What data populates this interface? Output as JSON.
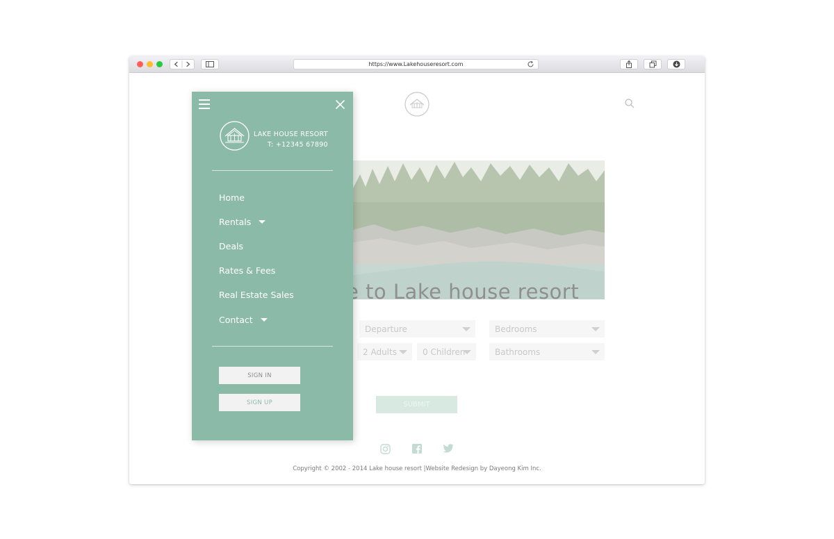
{
  "browser": {
    "url": "https://www.Lakehouseresort.com",
    "colors": {
      "close": "#ff5f57",
      "minimize": "#febc2e",
      "maximize": "#28c840"
    }
  },
  "page": {
    "welcome": "e to Lake house resort",
    "form": {
      "departure": "Departure",
      "bedrooms": "Bedrooms",
      "adults": "2 Adults",
      "children": "0 Children",
      "bathrooms": "Bathrooms",
      "submit": "SUBMIT"
    },
    "copyright": "Copyright © 2002 - 2014 Lake house resort |Website Redesign by Dayeong Kim Inc."
  },
  "menu": {
    "brand_name": "LAKE HOUSE RESORT",
    "brand_phone": "T: +12345 67890",
    "items": [
      {
        "label": "Home"
      },
      {
        "label": "Rentals"
      },
      {
        "label": "Deals"
      },
      {
        "label": "Rates & Fees"
      },
      {
        "label": "Real Estate Sales"
      },
      {
        "label": "Contact"
      }
    ],
    "sign_in": "SIGN IN",
    "sign_up": "SIGN UP",
    "colors": {
      "panel": "#8bbaa8",
      "sign_in_text": "#8a8a8a",
      "sign_up_text": "#8bbaa8"
    }
  }
}
